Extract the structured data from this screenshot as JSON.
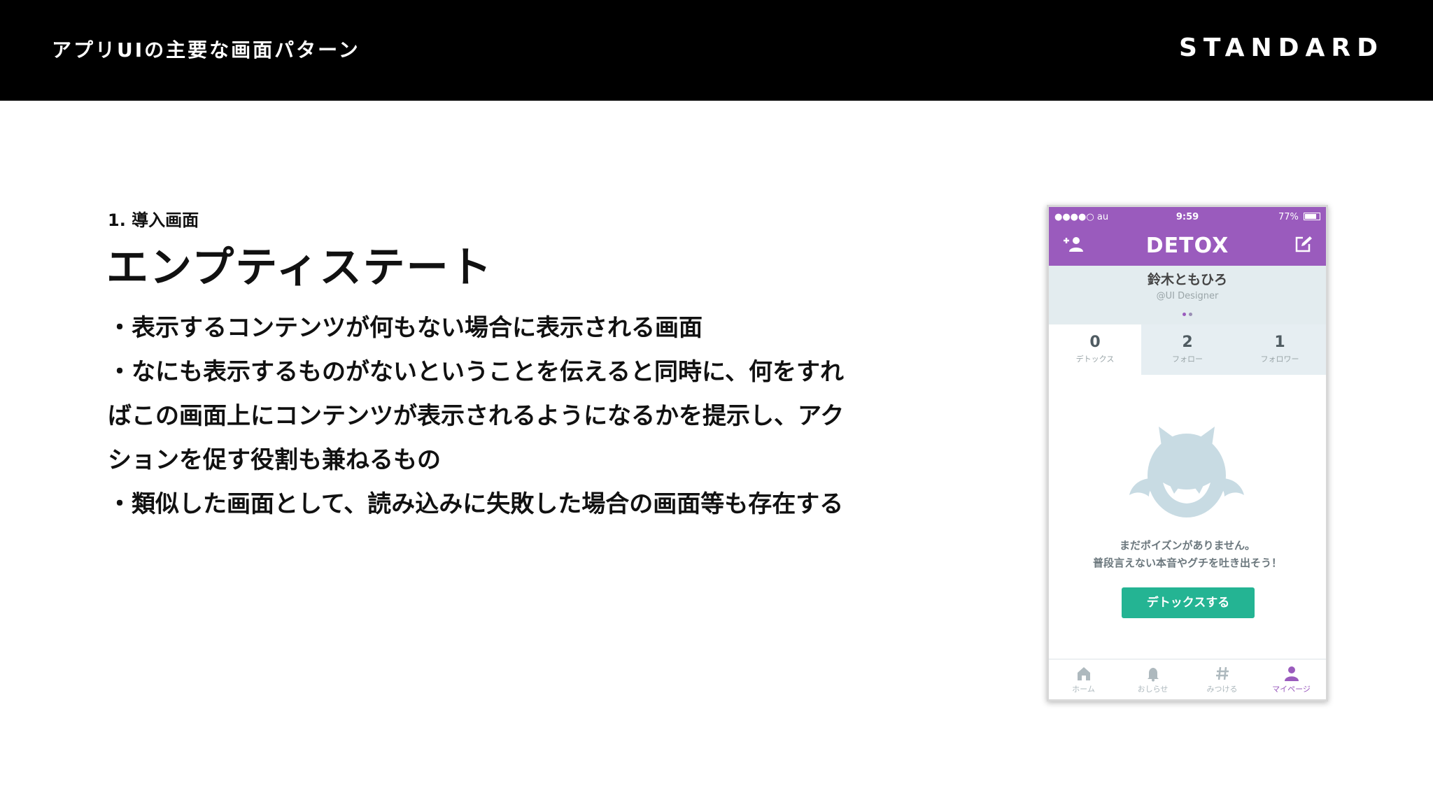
{
  "header": {
    "deck_title": "アプリUIの主要な画面パターン",
    "brand": "STANDARD"
  },
  "slide": {
    "section_label": "1. 導入画面",
    "heading": "エンプティステート",
    "bullets": [
      "・表示するコンテンツが何もない場合に表示される画面",
      "・なにも表示するものがないということを伝えると同時に、何をすれ",
      "ばこの画面上にコンテンツが表示されるようになるかを提示し、アク",
      "ションを促す役割も兼ねるもの",
      "・類似した画面として、読み込みに失敗した場合の画面等も存在する"
    ]
  },
  "phone": {
    "status": {
      "carrier": "●●●●○ au",
      "time": "9:59",
      "battery": "77%"
    },
    "app_name": "DETOX",
    "profile": {
      "name": "鈴木ともひろ",
      "handle": "@UI Designer"
    },
    "stats": [
      {
        "value": "0",
        "label": "デトックス"
      },
      {
        "value": "2",
        "label": "フォロー"
      },
      {
        "value": "1",
        "label": "フォロワー"
      }
    ],
    "empty_message": [
      "まだポイズンがありません。",
      "普段言えない本音やグチを吐き出そう！"
    ],
    "cta_label": "デトックスする",
    "tabs": [
      {
        "label": "ホーム",
        "icon": "home-icon"
      },
      {
        "label": "おしらせ",
        "icon": "bell-icon"
      },
      {
        "label": "みつける",
        "icon": "hash-icon"
      },
      {
        "label": "マイページ",
        "icon": "person-icon"
      }
    ],
    "colors": {
      "brand": "#9a5bbd",
      "cta": "#24b493",
      "mascot": "#c8dbe3"
    }
  }
}
